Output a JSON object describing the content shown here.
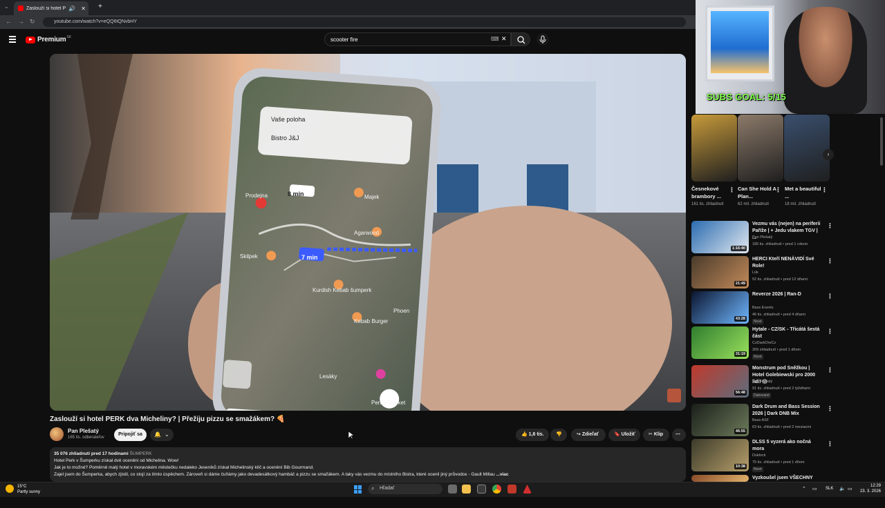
{
  "browser": {
    "tab_title": "Zaslouží si hotel PERK dva Micheli",
    "url": "youtube.com/watch?v=eQQ6tQNvbHY"
  },
  "masthead": {
    "logo_text": "Premium",
    "logo_country": "SK",
    "search_value": "scooter fire"
  },
  "video": {
    "title": "Zaslouží si hotel PERK dva Micheliny? | Přežiju pizzu se smažákem? 🍕",
    "channel": "Pan Plešatý",
    "subscribers": "165 tis. odberateľov",
    "join_label": "Pripojiť sa",
    "likes": "1,6 tis.",
    "share_label": "Zdieľať",
    "save_label": "Uložiť",
    "clip_label": "Klip",
    "phone_labels": [
      "Vaše poloha",
      "Bistro J&J",
      "8 min",
      "7 min",
      "Majek",
      "Agarwood",
      "Kurdish Kebab šumperk",
      "Kebab Burger",
      "Penny Market",
      "Prodejna",
      "Skilpek",
      "Lesáky",
      "Phoen"
    ]
  },
  "description": {
    "meta": "35 076 zhliadnutí  pred 17 hodinami",
    "tag": "ŠUMPERK",
    "line1": "Hotel Perk v Šumperku získal dvě ocenění od Michelina. Wow!",
    "line2": "Jak je to možné? Poměrně malý hotel v moravském městečku nedaleko Jeseníků získal Michelinský klíč a ocenění Bib Gourmand.",
    "line3": "Zajel jsem do Šumperka, abych zjistil, co stojí za tímto úspěchem. Zároveň si dáme čuňámy jako devadesátkový hambáč a pizzu se smažákem. A taky vás vezmu do místního Bistra, které ocenil jiný průvodce - Gault Millau",
    "more": "...viac"
  },
  "webcam": {
    "overlay_text": "SUBS GOAL: 5/15"
  },
  "shorts": [
    {
      "title": "Česnekové brambory ...",
      "views": "161 tis. zhliadnutí",
      "color": "#c79a3a"
    },
    {
      "title": "Can She Hold A Plan...",
      "views": "62 mil. zhliadnutí",
      "color": "#8c7a6a"
    },
    {
      "title": "Met a beautiful ...",
      "views": "18 mil. zhliadnutí",
      "color": "#3a4f6e"
    }
  ],
  "recommendations": [
    {
      "title": "Vezmu vás (nejen) na periferii Paříže | + Jedu vlakem TGV | ...",
      "channel": "Pan Plešatý",
      "views": "185 tis. zhliadnutí • pred 1 rokom",
      "duration": "1:16:40",
      "badge": "",
      "color1": "#2b6cb0",
      "color2": "#e2e8f0"
    },
    {
      "title": "HERCI Kteří NENÁVIDÍ Své Role!",
      "channel": "Lük",
      "views": "52 tis. zhliadnutí • pred 12 dňami",
      "duration": "21:49",
      "badge": "",
      "color1": "#4a3b2b",
      "color2": "#c28a5a"
    },
    {
      "title": "Reverze 2026 | Ran-D",
      "channel": "Bass Events",
      "views": "46 tis. zhliadnutí • pred 4 dňami",
      "duration": "43:28",
      "badge": "Nové",
      "color1": "#0b1530",
      "color2": "#6fb7ff"
    },
    {
      "title": "Hytale - CZ/SK - Třicátá šestá část",
      "channel": "CzDarkOreCz",
      "views": "309 zhliadnutí • pred 1 dňom",
      "duration": "31:19",
      "badge": "Nové",
      "color1": "#2f7d2f",
      "color2": "#9be15d"
    },
    {
      "title": "Monstrum pod Sněžkou | Hotel Golebiewski pro 2000 lidí! 😱",
      "channel": "Pan Plešatý",
      "views": "91 tis. zhliadnutí • pred 2 týždňami",
      "duration": "56:48",
      "badge": "Dabované",
      "color1": "#c0392b",
      "color2": "#5d6d7e"
    },
    {
      "title": "Dark Drum and Bass Session 2026 | Dark DNB Mix",
      "channel": "Bass ASF",
      "views": "63 tis. zhliadnutí • pred 2 mesiacmi",
      "duration": "46:55",
      "badge": "",
      "color1": "#1a1f1a",
      "color2": "#6d7a5a"
    },
    {
      "title": "DLSS 5 vyzerá ako nočná mora",
      "channel": "Duklock",
      "views": "75 tis. zhliadnutí • pred 1 dňom",
      "duration": "10:38",
      "badge": "Nové",
      "color1": "#3b3b2a",
      "color2": "#b89f6b"
    },
    {
      "title": "Vyzkoušel jsem VŠECHNY",
      "channel": "",
      "views": "",
      "duration": "",
      "badge": "",
      "color1": "#8a4b2a",
      "color2": "#e0b36b"
    }
  ],
  "taskbar": {
    "weather_temp": "15°C",
    "weather_desc": "Partly sunny",
    "search_placeholder": "Hľadať",
    "lang": "SLK",
    "time": "12:29",
    "date": "23. 3. 2026"
  }
}
